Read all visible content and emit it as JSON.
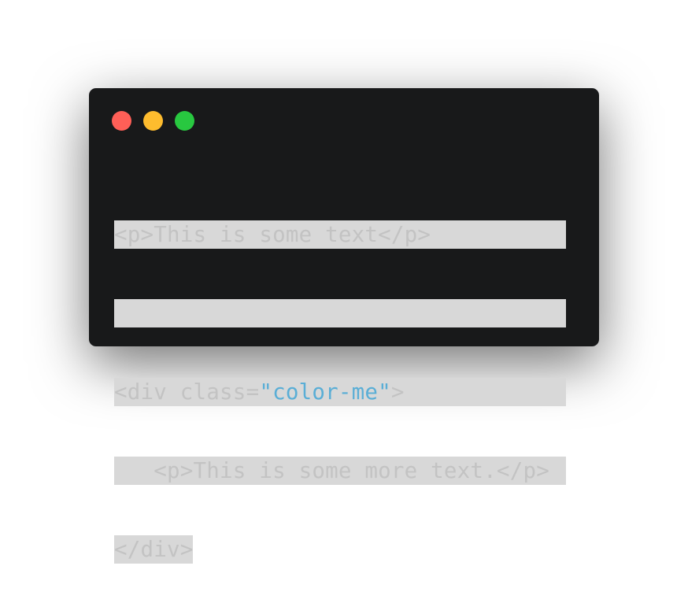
{
  "window_controls": {
    "close_color": "#ff5f57",
    "minimize_color": "#febc2e",
    "maximize_color": "#28c840"
  },
  "code_lines": [
    {
      "text": "<p>This is some text</p>"
    },
    {
      "text": ""
    },
    {
      "before": "<div class=",
      "string": "\"color-me\"",
      "after": ">"
    },
    {
      "text": "   <p>This is some more text.</p>"
    },
    {
      "text": "</div>"
    }
  ],
  "colors": {
    "window_bg": "#18191a",
    "selection_bg": "#d8d8d8",
    "code_text": "#c3c3c3",
    "string_literal": "#5aaed6"
  }
}
